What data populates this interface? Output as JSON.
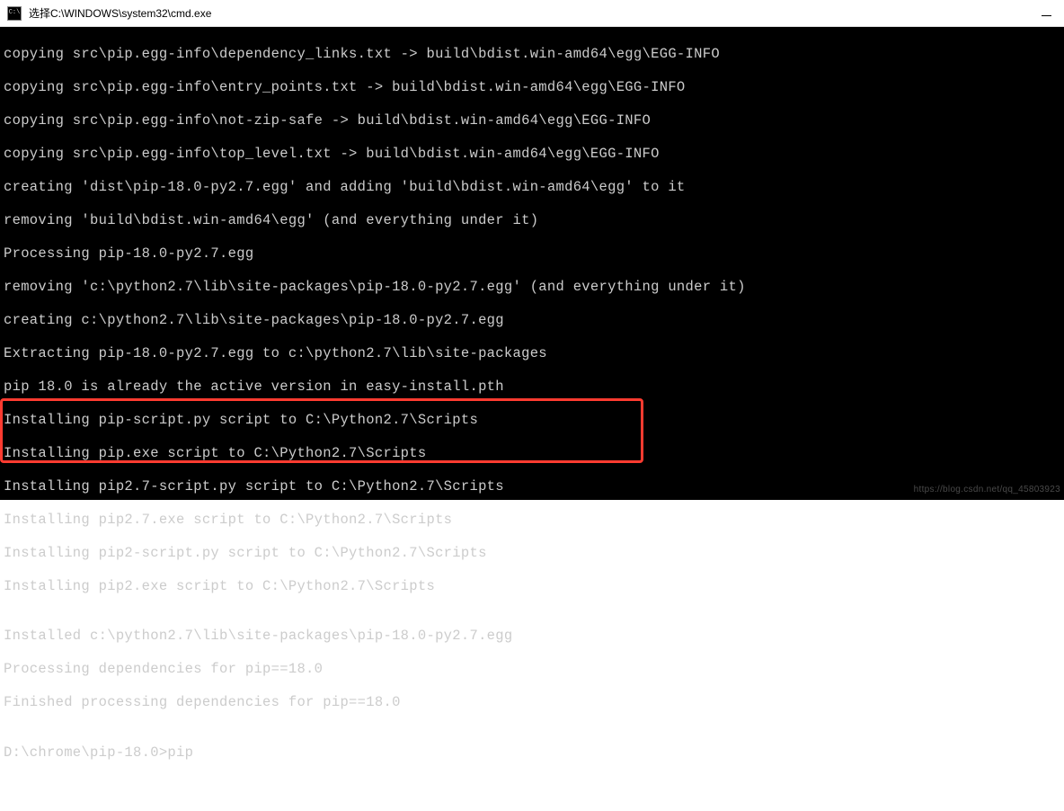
{
  "window": {
    "title": "选择C:\\WINDOWS\\system32\\cmd.exe"
  },
  "terminal": {
    "lines": [
      "copying src\\pip.egg-info\\dependency_links.txt -> build\\bdist.win-amd64\\egg\\EGG-INFO",
      "copying src\\pip.egg-info\\entry_points.txt -> build\\bdist.win-amd64\\egg\\EGG-INFO",
      "copying src\\pip.egg-info\\not-zip-safe -> build\\bdist.win-amd64\\egg\\EGG-INFO",
      "copying src\\pip.egg-info\\top_level.txt -> build\\bdist.win-amd64\\egg\\EGG-INFO",
      "creating 'dist\\pip-18.0-py2.7.egg' and adding 'build\\bdist.win-amd64\\egg' to it",
      "removing 'build\\bdist.win-amd64\\egg' (and everything under it)",
      "Processing pip-18.0-py2.7.egg",
      "removing 'c:\\python2.7\\lib\\site-packages\\pip-18.0-py2.7.egg' (and everything under it)",
      "creating c:\\python2.7\\lib\\site-packages\\pip-18.0-py2.7.egg",
      "Extracting pip-18.0-py2.7.egg to c:\\python2.7\\lib\\site-packages",
      "pip 18.0 is already the active version in easy-install.pth",
      "Installing pip-script.py script to C:\\Python2.7\\Scripts",
      "Installing pip.exe script to C:\\Python2.7\\Scripts",
      "Installing pip2.7-script.py script to C:\\Python2.7\\Scripts",
      "Installing pip2.7.exe script to C:\\Python2.7\\Scripts",
      "Installing pip2-script.py script to C:\\Python2.7\\Scripts",
      "Installing pip2.exe script to C:\\Python2.7\\Scripts",
      "",
      "Installed c:\\python2.7\\lib\\site-packages\\pip-18.0-py2.7.egg",
      "Processing dependencies for pip==18.0",
      "Finished processing dependencies for pip==18.0",
      "",
      "D:\\chrome\\pip-18.0>pip"
    ]
  },
  "watermark": "https://blog.csdn.net/qq_45803923"
}
